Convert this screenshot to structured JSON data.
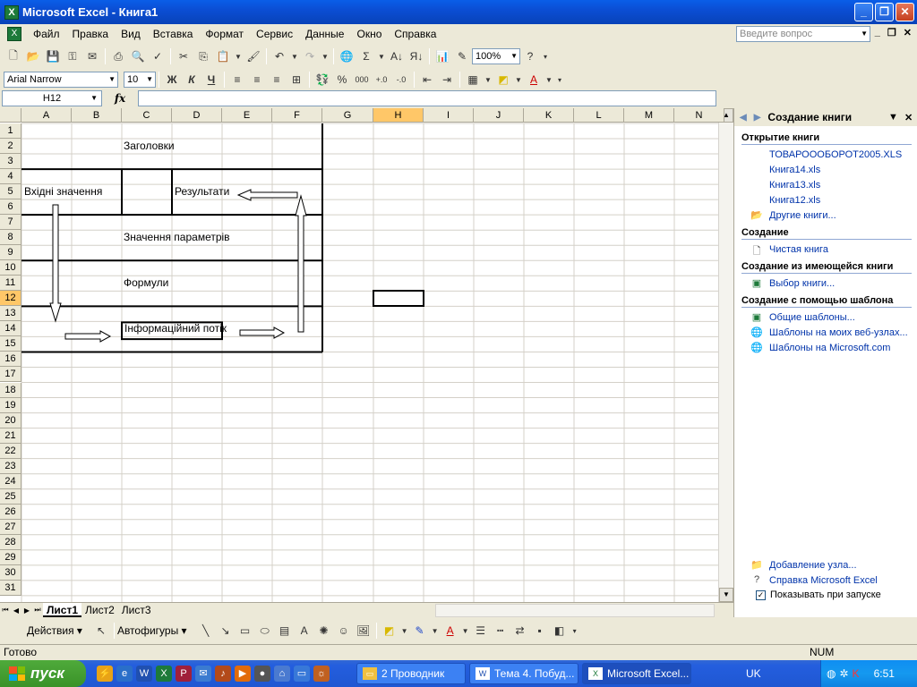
{
  "window": {
    "title": "Microsoft Excel - Книга1"
  },
  "menu": {
    "items": [
      "Файл",
      "Правка",
      "Вид",
      "Вставка",
      "Формат",
      "Сервис",
      "Данные",
      "Окно",
      "Справка"
    ],
    "ask_placeholder": "Введите вопрос"
  },
  "toolbar": {
    "zoom": "100%",
    "font": "Arial Narrow",
    "size": "10"
  },
  "formula_bar": {
    "name_box": "H12",
    "fx": "fx"
  },
  "grid": {
    "columns": [
      "A",
      "B",
      "C",
      "D",
      "E",
      "F",
      "G",
      "H",
      "I",
      "J",
      "K",
      "L",
      "M",
      "N"
    ],
    "rows": [
      "1",
      "2",
      "3",
      "4",
      "5",
      "6",
      "7",
      "8",
      "9",
      "10",
      "11",
      "12",
      "13",
      "14",
      "15",
      "16",
      "17",
      "18",
      "19",
      "20",
      "21",
      "22",
      "23",
      "24",
      "25",
      "26",
      "27",
      "28",
      "29",
      "30",
      "31"
    ],
    "active_column": "H",
    "active_row": "12",
    "texts": {
      "headings": "Заголовки",
      "inputs": "Вхідні значення",
      "results": "Результати",
      "params": "Значення параметрів",
      "formulas": "Формули",
      "infoflow": "Інформаційний потік"
    }
  },
  "sheet_tabs": [
    "Лист1",
    "Лист2",
    "Лист3"
  ],
  "task_pane": {
    "title": "Создание книги",
    "open_section": "Открытие книги",
    "files": [
      "ТОВАРОООБОРОТ2005.XLS",
      "Книга14.xls",
      "Книга13.xls",
      "Книга12.xls"
    ],
    "other_books": "Другие книги...",
    "create_section": "Создание",
    "blank_book": "Чистая книга",
    "from_existing_section": "Создание из имеющейся книги",
    "choose_book": "Выбор книги...",
    "template_section": "Создание с помощью шаблона",
    "general_templates": "Общие шаблоны...",
    "web_templates": "Шаблоны на моих веб-узлах...",
    "ms_templates": "Шаблоны на Microsoft.com",
    "add_site": "Добавление узла...",
    "help": "Справка Microsoft Excel",
    "show_at_startup": "Показывать при запуске"
  },
  "drawing": {
    "actions": "Действия",
    "autoshapes": "Автофигуры"
  },
  "status": {
    "ready": "Готово",
    "num": "NUM"
  },
  "taskbar": {
    "start": "пуск",
    "tasks": [
      "2 Проводник",
      "Тема 4. Побуд...",
      "Microsoft Excel..."
    ],
    "lang": "UK",
    "clock": "6:51"
  }
}
